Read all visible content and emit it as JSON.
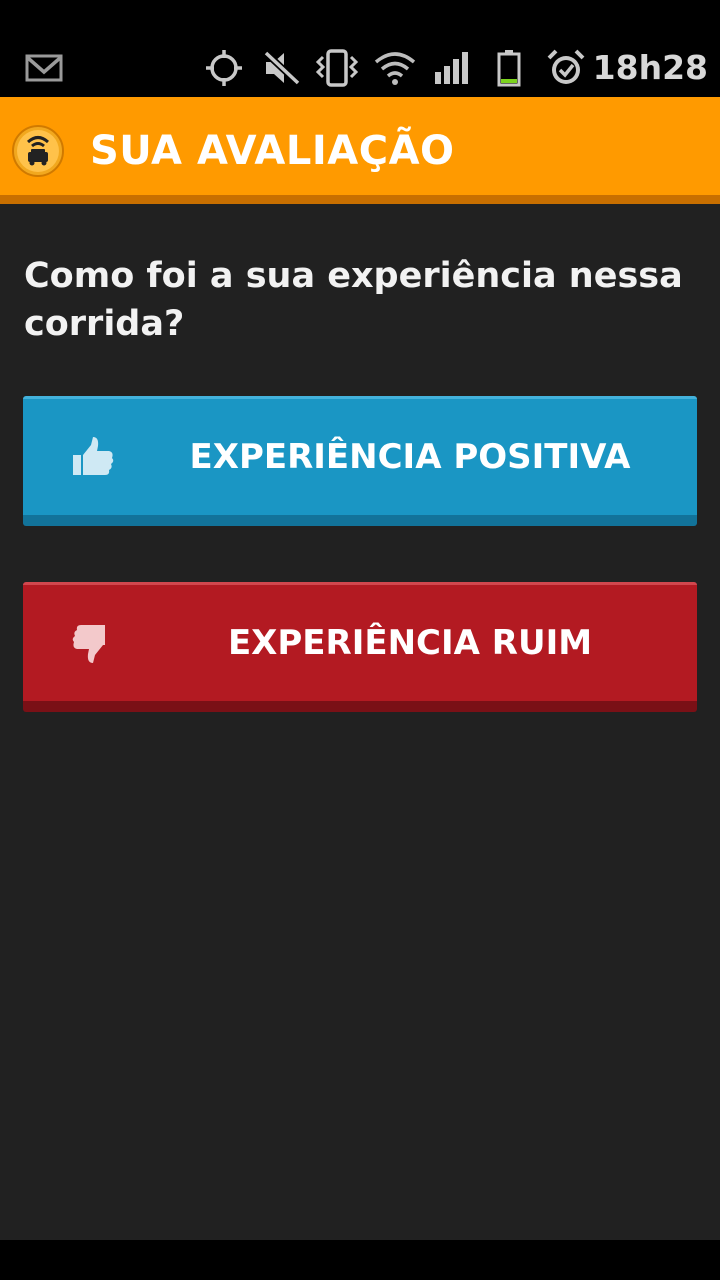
{
  "status_bar": {
    "time": "18h28",
    "icons": [
      "gmail-icon",
      "gps-icon",
      "muted-icon",
      "vibrate-icon",
      "wifi-icon",
      "signal-icon",
      "battery-icon",
      "alarm-icon"
    ]
  },
  "action_bar": {
    "title": "SUA AVALIAÇÃO",
    "logo_icon": "taxi-logo-icon",
    "color": "#ff9a00"
  },
  "main": {
    "question": "Como foi a sua experiência nessa corrida?",
    "positive_button": {
      "label": "EXPERIÊNCIA POSITIVA",
      "icon": "thumbs-up-icon",
      "color": "#1a96c4"
    },
    "negative_button": {
      "label": "EXPERIÊNCIA RUIM",
      "icon": "thumbs-down-icon",
      "color": "#b31a22"
    }
  }
}
